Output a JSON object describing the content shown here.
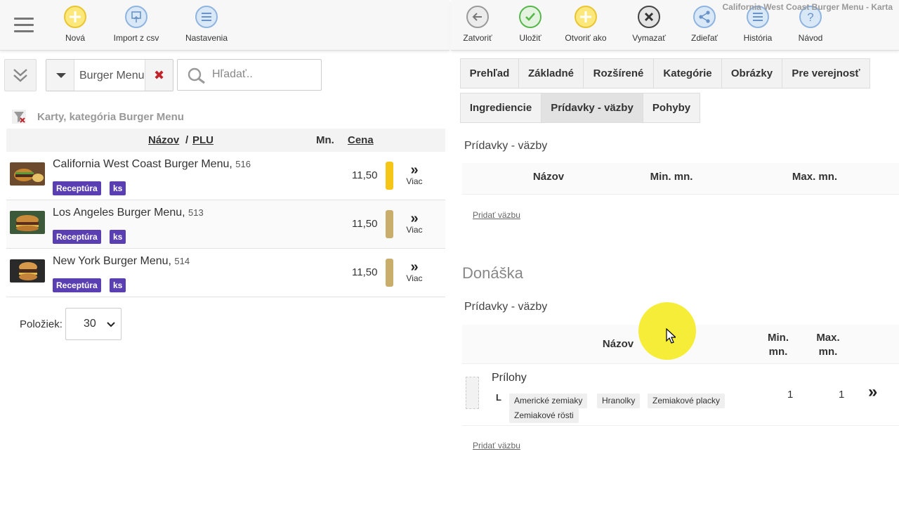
{
  "window_title": "California West Coast Burger Menu - Karta",
  "left_toolbar": {
    "buttons": [
      {
        "label": "Nová",
        "icon": "plus-icon"
      },
      {
        "label": "Import z csv",
        "icon": "import-icon"
      },
      {
        "label": "Nastavenia",
        "icon": "list-icon"
      }
    ]
  },
  "right_toolbar": {
    "buttons": [
      {
        "label": "Zatvoriť",
        "icon": "back-arrow-icon"
      },
      {
        "label": "Uložiť",
        "icon": "check-icon"
      },
      {
        "label": "Otvoriť ako",
        "icon": "plus-icon"
      },
      {
        "label": "Vymazať",
        "icon": "delete-x-icon"
      },
      {
        "label": "Zdieľať",
        "icon": "share-icon"
      },
      {
        "label": "História",
        "icon": "list-icon"
      },
      {
        "label": "Návod",
        "icon": "help-icon"
      }
    ]
  },
  "filter": {
    "value": "Burger Menu"
  },
  "search": {
    "placeholder": "Hľadať.."
  },
  "list": {
    "breadcrumb": "Karty, kategória Burger Menu",
    "headers": {
      "name": "Názov",
      "sep": "/",
      "plu": "PLU",
      "qty": "Mn.",
      "price": "Cena"
    },
    "rows": [
      {
        "name": "California West Coast Burger Menu",
        "plu": "516",
        "tag1": "Receptúra",
        "tag2": "ks",
        "price": "11,50",
        "bar_color": "#f5c518",
        "more": "Viac"
      },
      {
        "name": "Los Angeles Burger Menu",
        "plu": "513",
        "tag1": "Receptúra",
        "tag2": "ks",
        "price": "11,50",
        "bar_color": "#c9ad6b",
        "more": "Viac"
      },
      {
        "name": "New York Burger Menu",
        "plu": "514",
        "tag1": "Receptúra",
        "tag2": "ks",
        "price": "11,50",
        "bar_color": "#c9ad6b",
        "more": "Viac"
      }
    ],
    "per_page_label": "Položiek:",
    "per_page_value": "30"
  },
  "tabs": {
    "row1": [
      "Prehľad",
      "Základné",
      "Rozšírené",
      "Kategórie",
      "Obrázky",
      "Pre verejnosť"
    ],
    "row2": [
      "Ingrediencie",
      "Prídavky - väzby",
      "Pohyby"
    ],
    "active": "Prídavky - väzby"
  },
  "section1": {
    "subtitle": "Prídavky - väzby",
    "headers": {
      "name": "Názov",
      "min": "Min. mn.",
      "max": "Max. mn."
    },
    "add_link": "Pridať väzbu"
  },
  "section2": {
    "title": "Donáška",
    "subtitle": "Prídavky - väzby",
    "headers": {
      "name": "Názov",
      "min": "Min. mn.",
      "max": "Max. mn."
    },
    "row": {
      "name": "Prílohy",
      "branch": "L",
      "items": [
        "Americké zemiaky",
        "Hranolky",
        "Zemiakové placky",
        "Zemiakové rösti"
      ],
      "min": "1",
      "max": "1",
      "chevron": "»"
    },
    "add_link": "Pridať väzbu"
  },
  "colors": {
    "accent_badge": "#5a3fb3",
    "delete": "#c0232b",
    "highlight": "#f4ec2c"
  }
}
